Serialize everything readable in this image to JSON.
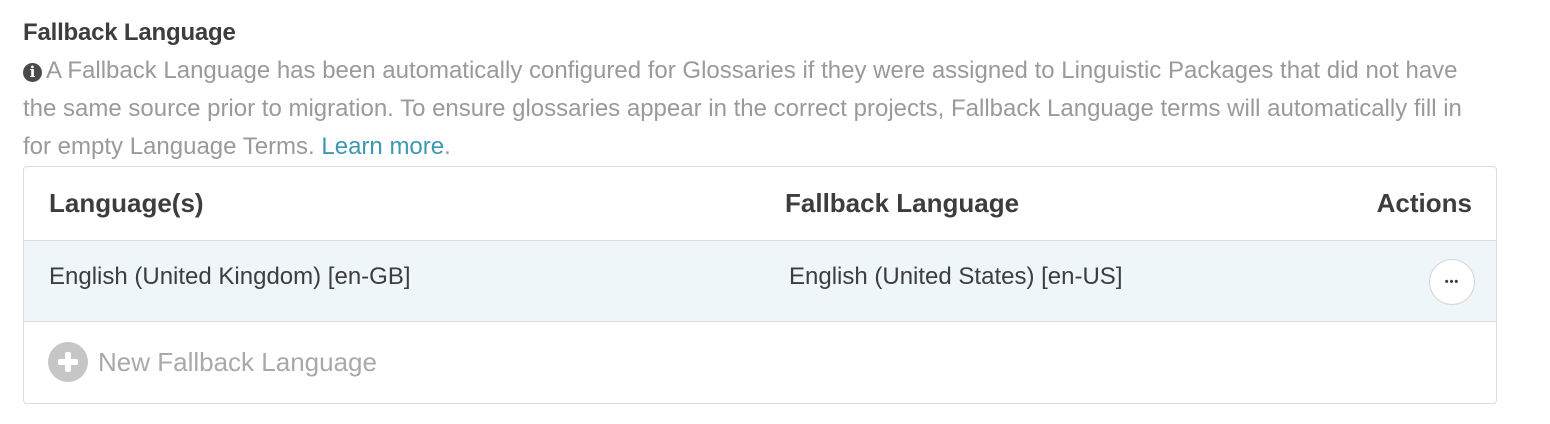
{
  "section": {
    "title": "Fallback Language",
    "info_icon": "info-circle-icon",
    "info_text": "A Fallback Language has been automatically configured for Glossaries if they were assigned to Linguistic Packages that did not have the same source prior to migration. To ensure glossaries appear in the correct projects, Fallback Language terms will automatically fill in for empty Language Terms.",
    "learn_more": "Learn more",
    "period": "."
  },
  "table": {
    "headers": {
      "languages": "Language(s)",
      "fallback": "Fallback Language",
      "actions": "Actions"
    },
    "rows": [
      {
        "languages": "English (United Kingdom) [en-GB]",
        "fallback": "English (United States) [en-US]",
        "actions_icon": "more-horizontal-icon",
        "actions_glyph": "•••"
      }
    ],
    "add_label": "New Fallback Language",
    "add_icon": "plus-circle-icon"
  },
  "colors": {
    "link": "#3c98b3",
    "row_highlight": "#eef6f9",
    "muted_text": "#9a9a9a"
  }
}
